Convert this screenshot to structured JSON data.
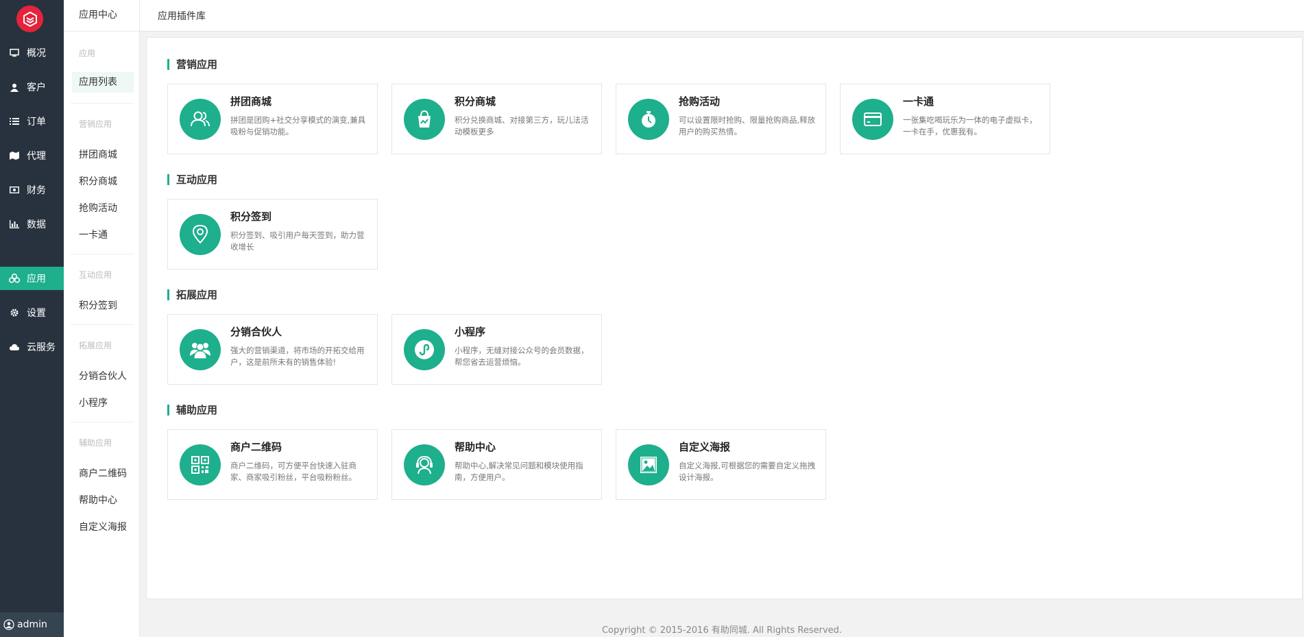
{
  "sidebar": {
    "items": [
      {
        "label": "概况",
        "icon": "monitor-icon"
      },
      {
        "label": "客户",
        "icon": "user-icon"
      },
      {
        "label": "订单",
        "icon": "list-icon"
      },
      {
        "label": "代理",
        "icon": "map-icon"
      },
      {
        "label": "财务",
        "icon": "money-icon"
      },
      {
        "label": "数据",
        "icon": "bar-chart-icon"
      },
      {
        "label": "应用",
        "icon": "cubes-icon",
        "active": true
      },
      {
        "label": "设置",
        "icon": "gear-icon"
      },
      {
        "label": "云服务",
        "icon": "cloud-icon"
      }
    ],
    "user": "admin"
  },
  "subnav": {
    "title": "应用中心",
    "groups": [
      {
        "label": "应用",
        "links": [
          "应用列表"
        ]
      },
      {
        "label": "营销应用",
        "links": [
          "拼团商城",
          "积分商城",
          "抢购活动",
          "一卡通"
        ]
      },
      {
        "label": "互动应用",
        "links": [
          "积分签到"
        ]
      },
      {
        "label": "拓展应用",
        "links": [
          "分销合伙人",
          "小程序"
        ]
      },
      {
        "label": "辅助应用",
        "links": [
          "商户二维码",
          "帮助中心",
          "自定义海报"
        ]
      }
    ]
  },
  "header": {
    "breadcrumb": "应用插件库"
  },
  "sections": [
    {
      "title": "营销应用",
      "cards": [
        {
          "title": "拼团商城",
          "desc": "拼团是团购+社交分享模式的演变,兼具吸粉与促销功能。",
          "icon": "users-icon"
        },
        {
          "title": "积分商城",
          "desc": "积分兑换商城、对接第三方，玩儿法活动模板更多",
          "icon": "shopping-bag-icon"
        },
        {
          "title": "抢购活动",
          "desc": "可以设置限时抢购、限量抢购商品,释放用户的购买热情。",
          "icon": "stopwatch-icon"
        },
        {
          "title": "一卡通",
          "desc": "一张集吃喝玩乐为一体的电子虚拟卡，一卡在手，优惠我有。",
          "icon": "card-icon"
        }
      ]
    },
    {
      "title": "互动应用",
      "cards": [
        {
          "title": "积分签到",
          "desc": "积分签到、吸引用户每天签到，助力营收增长",
          "icon": "location-pin-icon"
        }
      ]
    },
    {
      "title": "拓展应用",
      "cards": [
        {
          "title": "分销合伙人",
          "desc": "强大的营销渠道，将市场的开拓交给用户，这是前所未有的销售体验!",
          "icon": "partners-icon"
        },
        {
          "title": "小程序",
          "desc": "小程序，无缝对接公众号的会员数据，帮您省去运营烦恼。",
          "icon": "mini-program-icon"
        }
      ]
    },
    {
      "title": "辅助应用",
      "cards": [
        {
          "title": "商户二维码",
          "desc": "商户二维码，可方便平台快速入驻商家、商家吸引粉丝，平台吸粉粉丝。",
          "icon": "qrcode-icon"
        },
        {
          "title": "帮助中心",
          "desc": "帮助中心,解决常见问题和模块使用指南，方便用户。",
          "icon": "headset-icon"
        },
        {
          "title": "自定义海报",
          "desc": "自定义海报,可根据您的需要自定义拖拽设计海报。",
          "icon": "image-icon"
        }
      ]
    }
  ],
  "footer": "Copyright © 2015-2016 有助同城. All Rights Reserved.",
  "colors": {
    "accent": "#1eaf8d",
    "sidebar": "#28323e",
    "logo": "#e3243b"
  }
}
